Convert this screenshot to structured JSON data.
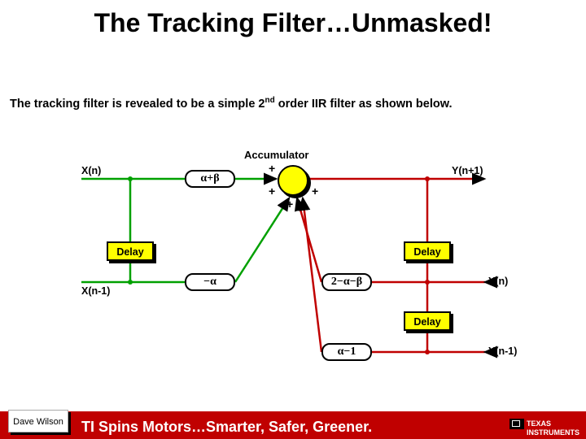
{
  "title": "The Tracking Filter…Unmasked!",
  "subtitle_pre": "The tracking filter is revealed to be a simple 2",
  "subtitle_sup": "nd",
  "subtitle_post": " order IIR filter as shown below.",
  "diagram": {
    "accumulator_label": "Accumulator",
    "signals": {
      "xn": "X(n)",
      "xn1": "X(n-1)",
      "ynp1": "Y(n+1)",
      "yn": "Y(n)",
      "yn1": "Y(n-1)"
    },
    "gains": {
      "ab": "α+β",
      "na": "−α",
      "mab": "2−α−β",
      "am1": "α−1"
    },
    "delay": "Delay",
    "plus": "+"
  },
  "footer": {
    "author": "Dave Wilson",
    "tagline": "TI Spins Motors…Smarter, Safer, Greener.",
    "logo1": "TEXAS",
    "logo2": "INSTRUMENTS"
  }
}
